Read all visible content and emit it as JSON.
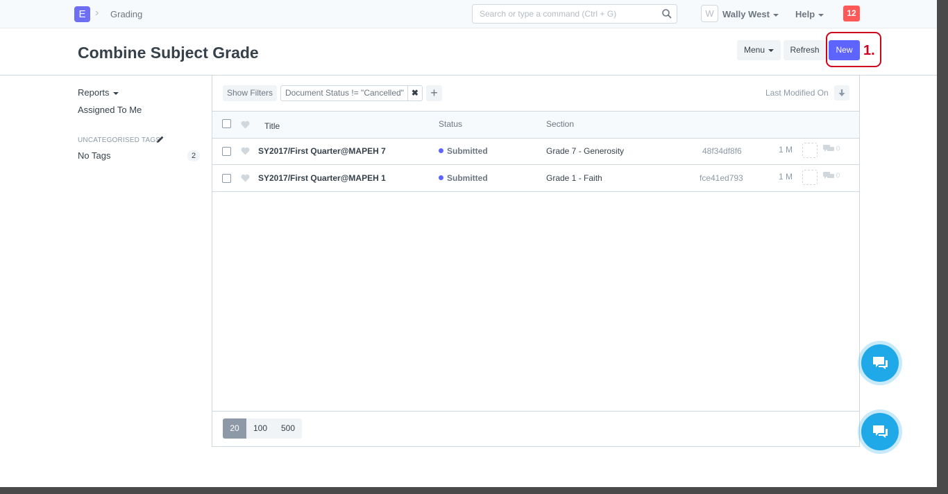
{
  "navbar": {
    "logo_letter": "E",
    "breadcrumb": "Grading",
    "search_placeholder": "Search or type a command (Ctrl + G)",
    "avatar_letter": "W",
    "user_name": "Wally West",
    "help_label": "Help",
    "notification_count": "12"
  },
  "page": {
    "title": "Combine Subject Grade",
    "menu_label": "Menu",
    "refresh_label": "Refresh",
    "new_label": "New",
    "annotation": "1."
  },
  "sidebar": {
    "reports": "Reports",
    "assigned_to_me": "Assigned To Me",
    "tags_heading": "UNCATEGORISED TAGS",
    "no_tags": "No Tags",
    "no_tags_count": "2"
  },
  "filters": {
    "show_filters": "Show Filters",
    "active_filter": "Document Status != \"Cancelled\"",
    "remove_symbol": "✖",
    "add_symbol": "+",
    "sort_label": "Last Modified On"
  },
  "columns": {
    "title": "Title",
    "status": "Status",
    "section": "Section"
  },
  "rows": [
    {
      "title": "SY2017/First Quarter@MAPEH 7",
      "status": "Submitted",
      "section": "Grade 7 - Generosity",
      "name": "48f34df8f6",
      "modified": "1 M",
      "comments": "0"
    },
    {
      "title": "SY2017/First Quarter@MAPEH 1",
      "status": "Submitted",
      "section": "Grade 1 - Faith",
      "name": "fce41ed793",
      "modified": "1 M",
      "comments": "0"
    }
  ],
  "paging": [
    "20",
    "100",
    "500"
  ],
  "colors": {
    "primary": "#5e64ff",
    "annotation": "#d0021b",
    "chat": "#1fa9e8",
    "notification": "#ff5858"
  }
}
